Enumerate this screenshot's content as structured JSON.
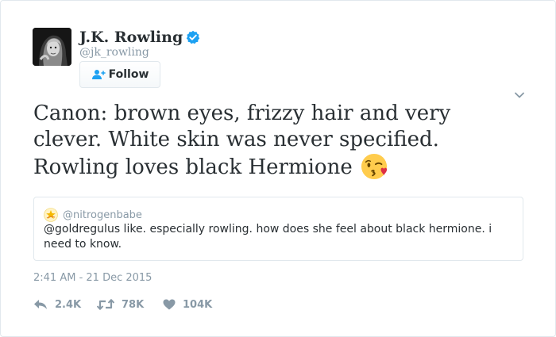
{
  "author": {
    "display_name": "J.K. Rowling",
    "handle": "@jk_rowling",
    "verified": true
  },
  "follow_button": {
    "label": "Follow"
  },
  "tweet": {
    "lines": [
      "Canon: brown eyes, frizzy hair and very",
      "clever. White skin was never specified.",
      "Rowling loves black Hermione"
    ],
    "emoji": "face-throwing-kiss"
  },
  "quoted_tweet": {
    "handle": "@nitrogenbabe",
    "text": "@goldregulus like. especially rowling. how does she feel about black hermione. i need to know."
  },
  "timestamp": "2:41 AM - 21 Dec 2015",
  "actions": {
    "reply_count": "2.4K",
    "retweet_count": "78K",
    "like_count": "104K"
  },
  "colors": {
    "text": "#292f33",
    "muted": "#8899a6",
    "border": "#e1e8ed",
    "verified": "#1da1f2",
    "follow_icon": "#1da1f2"
  }
}
